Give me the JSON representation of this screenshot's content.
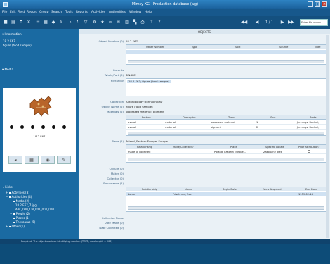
{
  "window": {
    "title": "Mimsy XG - Production database (wg)"
  },
  "menu": [
    "File",
    "Edit",
    "Field",
    "Record",
    "Group",
    "Search",
    "Tools",
    "Reports",
    "Activities",
    "Authorities",
    "Window",
    "Help"
  ],
  "toolbar": {
    "pager": "1 / 1",
    "search_placeholder": "Enter file words..."
  },
  "sidebar": {
    "information_title": "Information",
    "record_id": "18.2.E67",
    "record_desc": "figure (food sample)",
    "media_title": "Media",
    "media_caption": "18.2.E67",
    "links_title": "Links",
    "links": [
      "Activities (3)",
      "Authorities (4)",
      "Media (2)",
      "18.2.E67_7.jpg",
      "ARC_000_CM_001_000_000",
      "People (2)",
      "Places (1)",
      "Thesaurus (5)",
      "Other (1)"
    ]
  },
  "main": {
    "header": "OBJECTS",
    "object_number_label": "Object Number (0)",
    "object_number": "18.2.E67",
    "other_number_cols": [
      "Other Number",
      "Type",
      "Sort",
      "Source",
      "Note"
    ],
    "hazards_label": "Hazards",
    "wholepart_label": "Whole/Part (0)",
    "wholepart": "SINGLE",
    "hierarchy_label": "Hierarchy",
    "hierarchy": "18.2.E67; figure (food sample)",
    "collection_label": "Collection",
    "collection": "Anthropology; Ethnography",
    "objectname_label": "Object Name (2)",
    "objectname": "figure (food sample)",
    "materials_label": "Materials (2)",
    "materials": "processed material; pigment",
    "materials_cols": [
      "Portion",
      "Descriptor",
      "Term",
      "Sort",
      "Note"
    ],
    "materials_rows": [
      [
        "overall",
        "material",
        "processed material",
        "1",
        "Jennings, Rachel,"
      ],
      [
        "overall",
        "material",
        "pigment",
        "2",
        "Jennings, Rachel,"
      ]
    ],
    "place_label": "Place (1)",
    "place": "Poland, Eastern Europe, Europe",
    "place_cols": [
      "Relationship",
      "Made/Collected?",
      "Place",
      "Specific Locale",
      "Prior Attribution?"
    ],
    "place_rows": [
      [
        "made or collected",
        "",
        "Poland, Eastern Europe,...",
        "Zakopane area",
        ""
      ]
    ],
    "culture_label": "Culture (0)",
    "maker_label": "Maker (0)",
    "collector_label": "Collector (0)",
    "provenance_label": "Provenance (1)",
    "prov_cols": [
      "Relationship",
      "Name",
      "Begin Date",
      "View Acquired",
      "End Date"
    ],
    "prov_rows": [
      [
        "donor",
        "Frischmer, Eva",
        "",
        "",
        "1959-02-18"
      ]
    ],
    "collname_label": "Collection Name",
    "datemade_label": "Date Made (0)",
    "datecollected_label": "Date Collected (0)"
  },
  "status": "Required. The object's unique identifying number. (TEXT, max length = 200)"
}
